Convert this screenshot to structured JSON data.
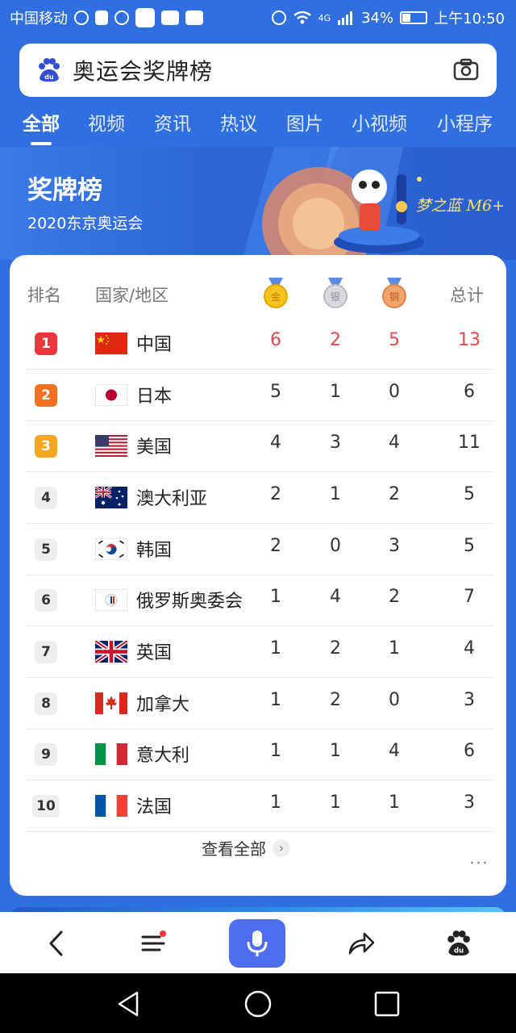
{
  "status_bar": {
    "carrier": "中国移动",
    "network": "4G",
    "battery": "34%",
    "time": "上午10:50"
  },
  "search": {
    "query": "奥运会奖牌榜"
  },
  "tabs": [
    {
      "label": "全部"
    },
    {
      "label": "视频"
    },
    {
      "label": "资讯"
    },
    {
      "label": "热议"
    },
    {
      "label": "图片"
    },
    {
      "label": "小视频"
    },
    {
      "label": "小程序"
    }
  ],
  "banner": {
    "title": "奖牌榜",
    "subtitle": "2020东京奥运会",
    "brand": "梦之蓝 M6+"
  },
  "table": {
    "headers": {
      "rank": "排名",
      "country": "国家/地区",
      "gold": "金",
      "silver": "银",
      "bronze": "铜",
      "total": "总计"
    },
    "rows": [
      {
        "rank": "1",
        "country": "中国",
        "gold": "6",
        "silver": "2",
        "bronze": "5",
        "total": "13",
        "flag": "china-flag"
      },
      {
        "rank": "2",
        "country": "日本",
        "gold": "5",
        "silver": "1",
        "bronze": "0",
        "total": "6",
        "flag": "japan-flag"
      },
      {
        "rank": "3",
        "country": "美国",
        "gold": "4",
        "silver": "3",
        "bronze": "4",
        "total": "11",
        "flag": "usa-flag"
      },
      {
        "rank": "4",
        "country": "澳大利亚",
        "gold": "2",
        "silver": "1",
        "bronze": "2",
        "total": "5",
        "flag": "australia-flag"
      },
      {
        "rank": "5",
        "country": "韩国",
        "gold": "2",
        "silver": "0",
        "bronze": "3",
        "total": "5",
        "flag": "korea-flag"
      },
      {
        "rank": "6",
        "country": "俄罗斯奥委会",
        "gold": "1",
        "silver": "4",
        "bronze": "2",
        "total": "7",
        "flag": "roc-flag"
      },
      {
        "rank": "7",
        "country": "英国",
        "gold": "1",
        "silver": "2",
        "bronze": "1",
        "total": "4",
        "flag": "uk-flag"
      },
      {
        "rank": "8",
        "country": "加拿大",
        "gold": "1",
        "silver": "2",
        "bronze": "0",
        "total": "3",
        "flag": "canada-flag"
      },
      {
        "rank": "9",
        "country": "意大利",
        "gold": "1",
        "silver": "1",
        "bronze": "4",
        "total": "6",
        "flag": "italy-flag"
      },
      {
        "rank": "10",
        "country": "法国",
        "gold": "1",
        "silver": "1",
        "bronze": "1",
        "total": "3",
        "flag": "france-flag"
      }
    ],
    "view_all": "查看全部"
  },
  "colors": {
    "brand_blue": "#2f6fdf",
    "rank1": "#f0363d",
    "rank2": "#f5701f",
    "rank3": "#f5a623",
    "highlight_number": "#e5484d"
  }
}
